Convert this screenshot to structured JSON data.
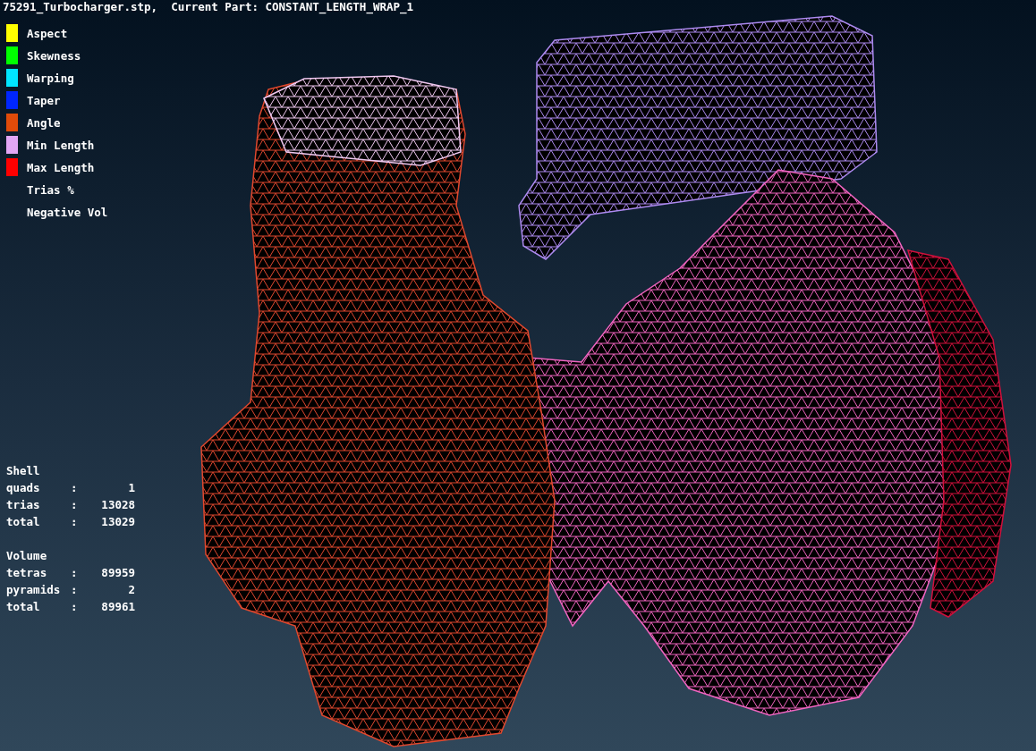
{
  "viewport": {
    "title": "75291_Turbocharger.stp,  Current Part: CONSTANT_LENGTH_WRAP_1"
  },
  "legend": [
    {
      "label": "Aspect",
      "kind": "swatch",
      "color": "#ffff00"
    },
    {
      "label": "Skewness",
      "kind": "swatch",
      "color": "#00ff00"
    },
    {
      "label": "Warping",
      "kind": "swatch",
      "color": "#00e5ff"
    },
    {
      "label": "Taper",
      "kind": "swatch",
      "color": "#0026ff"
    },
    {
      "label": "Angle",
      "kind": "swatch",
      "color": "#e04b0a"
    },
    {
      "label": "Min Length",
      "kind": "swatch",
      "color": "#e2a6f5"
    },
    {
      "label": "Max Length",
      "kind": "swatch",
      "color": "#ff0000"
    },
    {
      "label": "Trias %",
      "kind": "plain"
    },
    {
      "label": "Negative Vol",
      "kind": "plain"
    }
  ],
  "stats": [
    {
      "heading": "Shell",
      "rows": [
        {
          "label": "quads",
          "separator": ":",
          "value": "1"
        },
        {
          "label": "trias",
          "separator": ":",
          "value": "13028"
        },
        {
          "label": "total",
          "separator": ":",
          "value": "13029"
        }
      ]
    },
    {
      "heading": "Volume",
      "rows": [
        {
          "label": "tetras",
          "separator": ":",
          "value": "89959"
        },
        {
          "label": "pyramids",
          "separator": ":",
          "value": "2"
        },
        {
          "label": "total",
          "separator": ":",
          "value": "89961"
        }
      ]
    }
  ]
}
